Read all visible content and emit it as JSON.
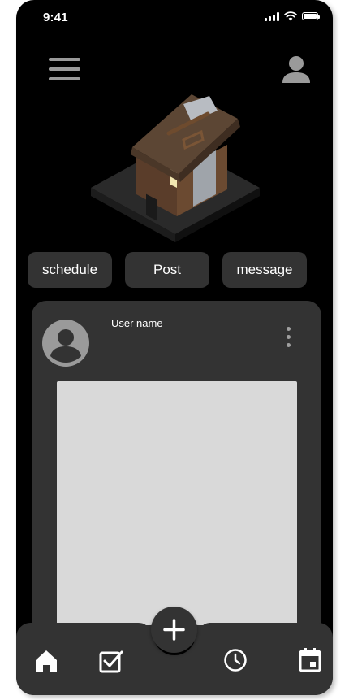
{
  "status_bar": {
    "time": "9:41",
    "battery_level": 1.0
  },
  "header": {
    "menu_icon": "hamburger-menu-icon",
    "profile_icon": "user-profile-icon"
  },
  "hero": {
    "icon": "isometric-wooden-hut-illustration"
  },
  "tabs": [
    {
      "label": "schedule"
    },
    {
      "label": "Post"
    },
    {
      "label": "message"
    }
  ],
  "post": {
    "username": "User name",
    "avatar_icon": "user-avatar-icon",
    "more_icon": "more-vertical-icon",
    "image_placeholder_color": "#d9d9d9"
  },
  "bottom_nav": {
    "items": [
      {
        "icon": "home-icon"
      },
      {
        "icon": "checkbox-icon"
      },
      {
        "icon": "clock-icon"
      },
      {
        "icon": "calendar-icon"
      }
    ],
    "fab_icon": "plus-icon"
  },
  "colors": {
    "background": "#000000",
    "surface": "#333333",
    "icon_gray": "#9a9a9a",
    "text": "#ffffff",
    "page": "#ffffff"
  }
}
